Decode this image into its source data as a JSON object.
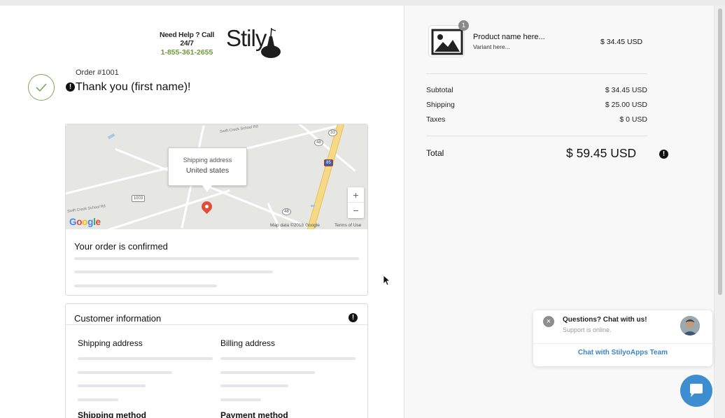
{
  "header": {
    "help_line1": "Need Help ? Call 24/7",
    "help_phone": "1-855-361-2655",
    "brand": "Stily"
  },
  "order": {
    "number": "Order #1001",
    "thanks": "Thank you (first name)!",
    "alert_symbol": "!"
  },
  "map": {
    "tooltip_label": "Shipping address",
    "tooltip_value": "United states",
    "zoom_in": "+",
    "zoom_out": "−",
    "google": "Google",
    "map_data": "Map data ©2018 Google",
    "terms": "Terms of Use",
    "road_labels": [
      "Swift Creek School Rd",
      "Swift Creek School Rd"
    ],
    "shields": [
      "33",
      "48",
      "1003",
      "48"
    ],
    "interstate": "85"
  },
  "confirmed": {
    "title": "Your order is confirmed"
  },
  "customer": {
    "title": "Customer information",
    "shipping_address": "Shipping address",
    "billing_address": "Billing address",
    "shipping_method": "Shipping method",
    "payment_method": "Payment method"
  },
  "summary": {
    "qty": "1",
    "product_name": "Product name here...",
    "variant": "Variant here...",
    "product_price": "$ 34.45 USD",
    "subtotal_label": "Subtotal",
    "subtotal": "$ 34.45 USD",
    "shipping_label": "Shipping",
    "shipping": "$ 25.00 USD",
    "taxes_label": "Taxes",
    "taxes": "$ 0 USD",
    "total_label": "Total",
    "total": "$ 59.45 USD"
  },
  "chat": {
    "close": "×",
    "question": "Questions? Chat with us!",
    "status": "Support is online.",
    "link": "Chat with StilyoApps Team"
  },
  "colors": {
    "accent_green": "#7fa65a",
    "chat_blue": "#3d8ed1",
    "pin_red": "#e34d3b"
  }
}
